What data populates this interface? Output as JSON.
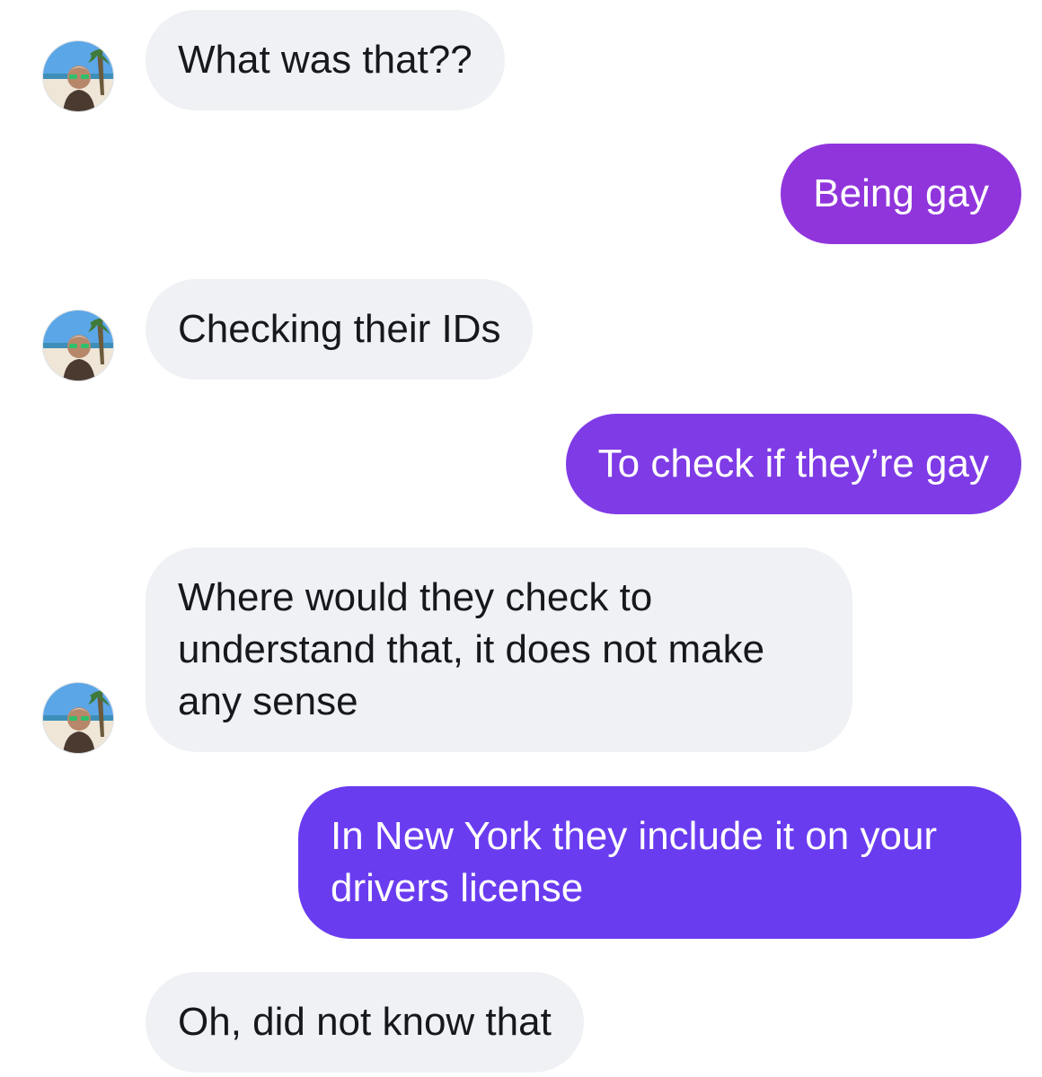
{
  "conversation": {
    "contact_avatar_icon": "avatar-photo-beach-person",
    "colors": {
      "incoming_bubble": "#eff1f4",
      "outgoing_1": "#9035dc",
      "outgoing_2": "#7f3be6",
      "outgoing_3": "#6a3cf0"
    },
    "messages": [
      {
        "sender": "contact",
        "text": "What was that??"
      },
      {
        "sender": "me",
        "text": "Being gay"
      },
      {
        "sender": "contact",
        "text": "Checking their IDs"
      },
      {
        "sender": "me",
        "text": "To check if they’re gay"
      },
      {
        "sender": "contact",
        "text": "Where would they check to\nunderstand that, it does not make\nany sense"
      },
      {
        "sender": "me",
        "text": "In New York they include it on your\ndrivers license"
      },
      {
        "sender": "contact",
        "text": "Oh, did not know that"
      }
    ]
  }
}
